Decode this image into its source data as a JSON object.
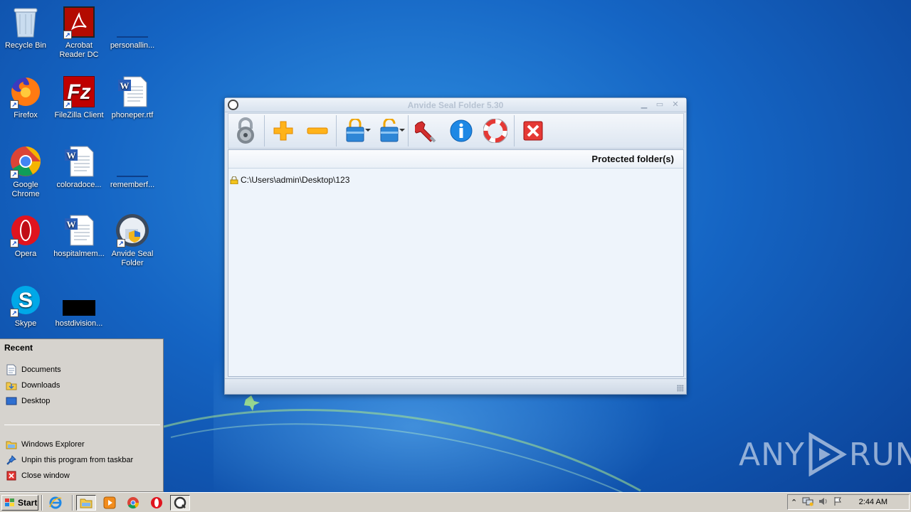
{
  "desktop": {
    "icons": [
      {
        "label": "Recycle Bin",
        "icon": "recycle-bin-icon"
      },
      {
        "label": "Acrobat Reader DC",
        "icon": "acrobat-reader-icon"
      },
      {
        "label": "personallin...",
        "icon": "file-icon"
      },
      {
        "label": "Firefox",
        "icon": "firefox-icon"
      },
      {
        "label": "FileZilla Client",
        "icon": "filezilla-icon"
      },
      {
        "label": "phoneper.rtf",
        "icon": "word-document-icon"
      },
      {
        "label": "Google Chrome",
        "icon": "chrome-icon"
      },
      {
        "label": "coloradoce...",
        "icon": "word-document-icon"
      },
      {
        "label": "rememberf...",
        "icon": "file-icon"
      },
      {
        "label": "Opera",
        "icon": "opera-icon"
      },
      {
        "label": "hospitalmem...",
        "icon": "word-document-icon"
      },
      {
        "label": "Anvide Seal Folder",
        "icon": "anvide-seal-folder-icon"
      },
      {
        "label": "Skype",
        "icon": "skype-icon"
      },
      {
        "label": "hostdivision...",
        "icon": "black-file-icon"
      }
    ]
  },
  "app_window": {
    "title": "Anvide Seal Folder 5.30",
    "controls": [
      "minimize",
      "maximize",
      "close"
    ],
    "toolbar": [
      {
        "name": "lock-toggle",
        "icon": "padlock-icon"
      },
      {
        "name": "add-folder",
        "icon": "plus-icon"
      },
      {
        "name": "remove-folder",
        "icon": "minus-icon"
      },
      {
        "name": "close-access",
        "icon": "locked-folder-icon",
        "has_dropdown": true
      },
      {
        "name": "open-access",
        "icon": "unlocked-folder-icon",
        "has_dropdown": true
      },
      {
        "name": "settings",
        "icon": "wrench-icon"
      },
      {
        "name": "about",
        "icon": "info-icon"
      },
      {
        "name": "help",
        "icon": "lifebuoy-icon"
      },
      {
        "name": "exit",
        "icon": "red-x-icon"
      }
    ],
    "column_header": "Protected folder(s)",
    "folders": [
      {
        "path": "C:\\Users\\admin\\Desktop\\123"
      }
    ]
  },
  "jumplist": {
    "heading": "Recent",
    "recent": [
      {
        "label": "Documents",
        "icon": "documents-icon"
      },
      {
        "label": "Downloads",
        "icon": "downloads-icon"
      },
      {
        "label": "Desktop",
        "icon": "desktop-icon"
      }
    ],
    "tasks": [
      {
        "label": "Windows Explorer",
        "icon": "explorer-icon"
      },
      {
        "label": "Unpin this program from taskbar",
        "icon": "unpin-icon"
      },
      {
        "label": "Close window",
        "icon": "close-window-icon"
      }
    ]
  },
  "taskbar": {
    "start_label": "Start",
    "pinned": [
      "internet-explorer-icon",
      "windows-explorer-icon",
      "media-player-icon",
      "chrome-icon",
      "opera-icon",
      "anvide-seal-folder-icon"
    ],
    "clock": "2:44 AM"
  },
  "watermark": {
    "left": "ANY",
    "right": "RUN"
  },
  "colors": {
    "accent": "#1565c4",
    "title_text": "#b7c3d2"
  }
}
